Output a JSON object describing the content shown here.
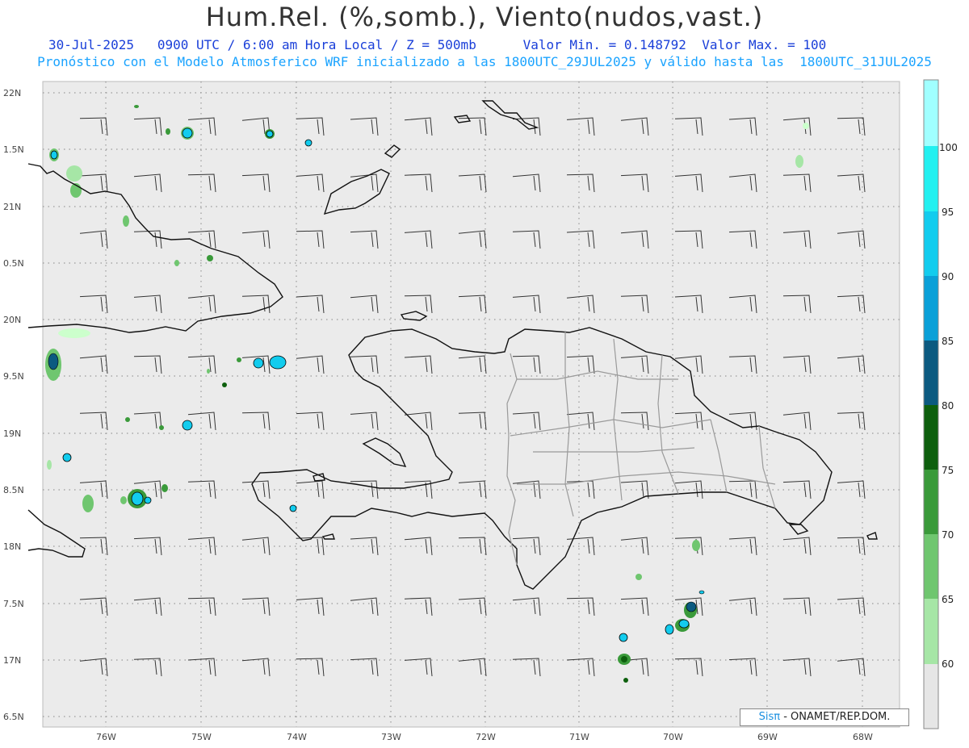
{
  "header": {
    "title": "Hum.Rel. (%,somb.), Viento(nudos,vast.)",
    "date": "30-Jul-2025",
    "time_info": "0900 UTC / 6:00 am Hora Local / Z = 500mb",
    "value_min": "Valor Min. = 0.148792",
    "value_max": "Valor Max. = 100",
    "model_info": "Pronóstico con el Modelo Atmosferico WRF inicializado a las 1800UTC_29JUL2025 y válido hasta las  1800UTC_31JUL2025"
  },
  "axes": {
    "lat_labels": [
      "22N",
      "1.5N",
      "21N",
      "0.5N",
      "20N",
      "9.5N",
      "19N",
      "8.5N",
      "18N",
      "7.5N",
      "17N",
      "6.5N"
    ],
    "lon_labels": [
      "76W",
      "75W",
      "74W",
      "73W",
      "72W",
      "71W",
      "70W",
      "69W",
      "68W"
    ]
  },
  "colorbar": {
    "labels": [
      "60",
      "65",
      "70",
      "75",
      "80",
      "85",
      "90",
      "95",
      "100"
    ],
    "colors": [
      "#e6e6e6",
      "#ccffcc",
      "#a6e6a6",
      "#6fc66f",
      "#3a9a3a",
      "#0d5f0d",
      "#0b5a80",
      "#0aa0d8",
      "#12ccee",
      "#22f0f0",
      "#a0ffff"
    ]
  },
  "credit": {
    "brand": "Sisπ",
    "text": " - ONAMET/REP.DOM."
  }
}
